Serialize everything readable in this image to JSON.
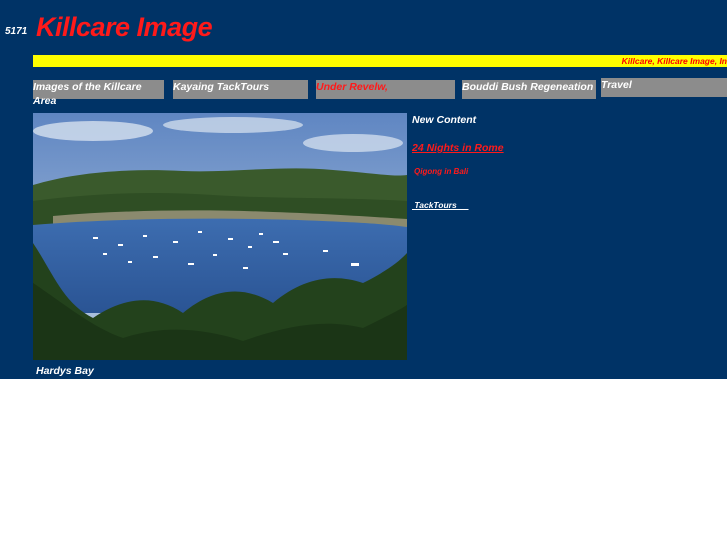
{
  "header": {
    "code": "5171",
    "title": "Killcare Image",
    "ticker": "Killcare, Killcare Image, In"
  },
  "nav": [
    {
      "label": "Images of the Killcare Area"
    },
    {
      "label": "Kayaing TackTours"
    },
    {
      "label": "Under Revelw,"
    },
    {
      "label": "Bouddi Bush Regeneation"
    },
    {
      "label": "Travel"
    }
  ],
  "main": {
    "caption": "Hardys Bay"
  },
  "sidebar": {
    "heading": "New Content",
    "links": [
      {
        "label": "24 Nights in Rome  "
      },
      {
        "label": "Qigong in Bali"
      },
      {
        "label": " TackTours     "
      }
    ]
  },
  "colors": {
    "background": "#003366",
    "ticker_bg": "#ffff00",
    "accent_red": "#ff1a1a",
    "nav_bg": "#8c8c8c"
  }
}
